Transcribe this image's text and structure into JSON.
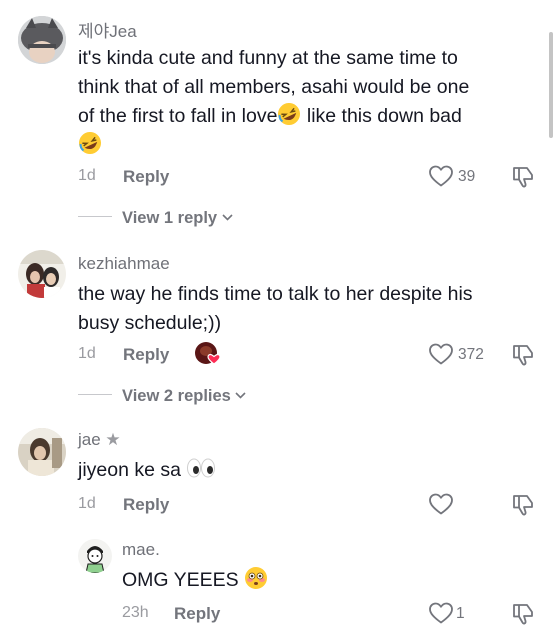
{
  "comments": [
    {
      "username": "제야Jea",
      "text_line1": "it's kinda cute and funny at the same time to",
      "text_line2": "think that of all members, asahi would be one",
      "text_line3a": "of the first to fall in love",
      "text_line3b": " like this down bad",
      "emoji": "rolling-on-floor-laughing-emoji",
      "time": "1d",
      "reply_label": "Reply",
      "likes": "39",
      "view_replies": "View 1 reply"
    },
    {
      "username": "kezhiahmae",
      "text_line1": "the way he finds time to talk to her despite his",
      "text_line2": "busy schedule;))",
      "time": "1d",
      "reply_label": "Reply",
      "likes": "372",
      "view_replies": "View 2 replies",
      "creator_liked": true
    },
    {
      "username": "jae",
      "username_badge": "★",
      "text": "jiyeon ke sa",
      "emoji": "eyes-emoji",
      "time": "1d",
      "reply_label": "Reply",
      "likes": ""
    }
  ],
  "reply": {
    "username": "mae.",
    "text": "OMG YEEES",
    "emoji": "flushed-face-emoji",
    "time": "23h",
    "reply_label": "Reply",
    "likes": "1"
  },
  "icons": {
    "like": "heart-outline-icon",
    "dislike": "thumbs-down-outline-icon",
    "expand": "chevron-down-icon"
  },
  "colors": {
    "text": "#161823",
    "secondary": "#73757c",
    "creator_heart": "#fe2c55"
  }
}
